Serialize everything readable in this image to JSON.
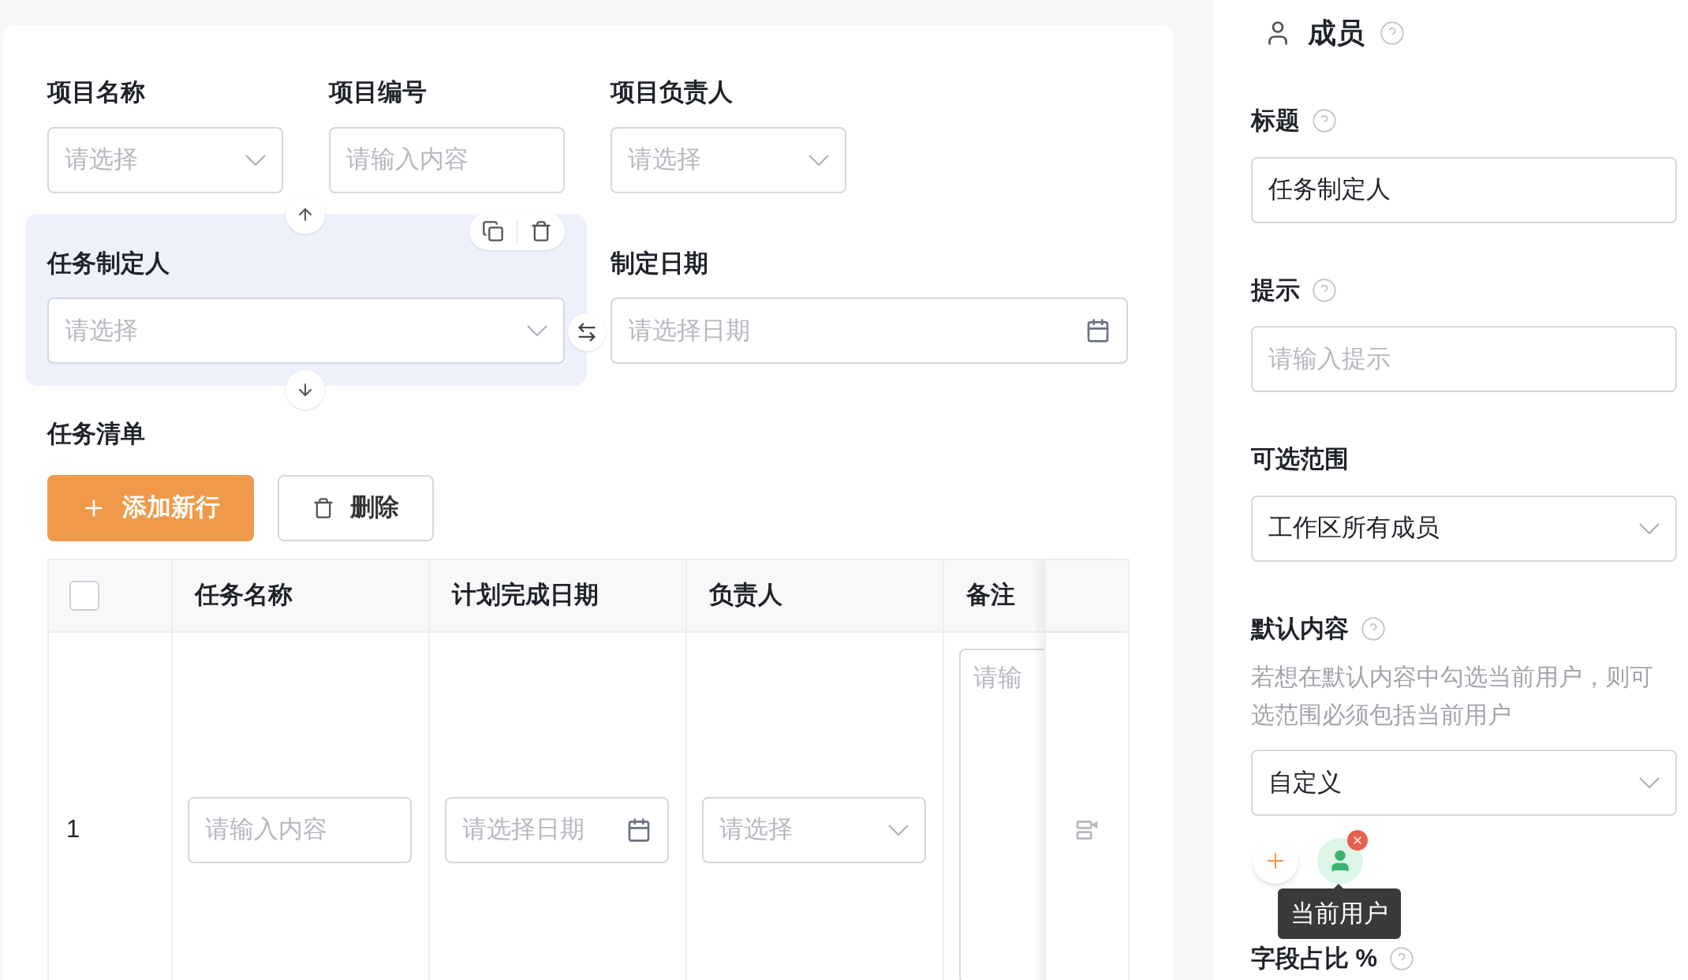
{
  "form": {
    "rows": [
      {
        "fields": [
          {
            "label": "项目名称",
            "kind": "select",
            "placeholder": "请选择",
            "selected": false
          },
          {
            "label": "项目编号",
            "kind": "input",
            "placeholder": "请输入内容",
            "selected": false
          },
          {
            "label": "项目负责人",
            "kind": "select",
            "placeholder": "请选择",
            "selected": false
          }
        ]
      },
      {
        "fields": [
          {
            "label": "任务制定人",
            "kind": "select",
            "placeholder": "请选择",
            "selected": true
          },
          {
            "label": "制定日期",
            "kind": "date",
            "placeholder": "请选择日期",
            "selected": false
          }
        ]
      }
    ],
    "table_section": {
      "label": "任务清单",
      "buttons": [
        {
          "kind": "primary",
          "label": "添加新行"
        },
        {
          "kind": "delete",
          "label": "删除"
        }
      ],
      "table": {
        "header_checkbox": {
          "checked": false
        },
        "columns": [
          "任务名称",
          "计划完成日期",
          "负责人",
          "备注"
        ],
        "rows": [
          {
            "index": "1",
            "cells": [
              {
                "kind": "input",
                "placeholder": "请输入内容"
              },
              {
                "kind": "date",
                "placeholder": "请选择日期"
              },
              {
                "kind": "select",
                "placeholder": "请选择"
              },
              {
                "kind": "textarea",
                "placeholder": "请输"
              }
            ]
          }
        ]
      }
    }
  },
  "panel": {
    "title": "成员",
    "properties": [
      {
        "label": "标题",
        "help": true,
        "kind": "input",
        "value": "任务制定人"
      },
      {
        "label": "提示",
        "help": true,
        "kind": "input",
        "placeholder": "请输入提示"
      },
      {
        "label": "可选范围",
        "help": false,
        "kind": "select",
        "value": "工作区所有成员"
      },
      {
        "label": "默认内容",
        "help": true,
        "kind": "members",
        "description": "若想在默认内容中勾选当前用户，则可选范围必须包括当前用户",
        "value": "自定义",
        "tooltip": "当前用户"
      },
      {
        "label": "字段占比 %",
        "help": true,
        "kind": "label"
      }
    ]
  }
}
